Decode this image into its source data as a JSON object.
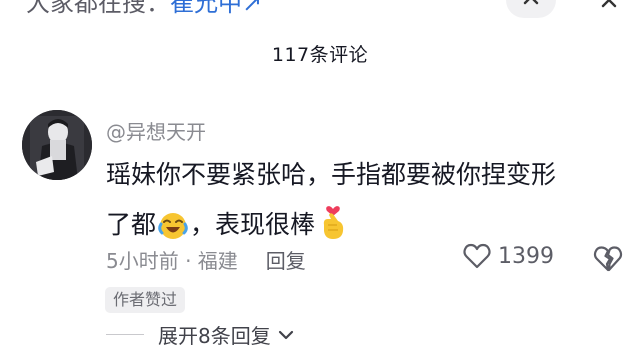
{
  "topbar": {
    "search_prefix": "大家都在搜：",
    "search_keyword": "崔允中",
    "search_arrow": "↗",
    "expand_icon": "chevron-up-icon",
    "close_icon": "close-icon"
  },
  "comments": {
    "count_label": "117条评论"
  },
  "comment": {
    "username": "@异想天开",
    "text_line1": "瑶妹你不要紧张哈，手指都要被你捏变形",
    "text_line2_a": "了都",
    "text_line2_b": "，表现很棒",
    "time_location": "5小时前 · 福建",
    "reply_label": "回复",
    "like_count": "1399",
    "author_badge": "作者赞过",
    "expand_label": "展开8条回复",
    "colors": {
      "text": "#161823",
      "muted": "#8a8b91",
      "link": "#2f6fd6"
    }
  }
}
